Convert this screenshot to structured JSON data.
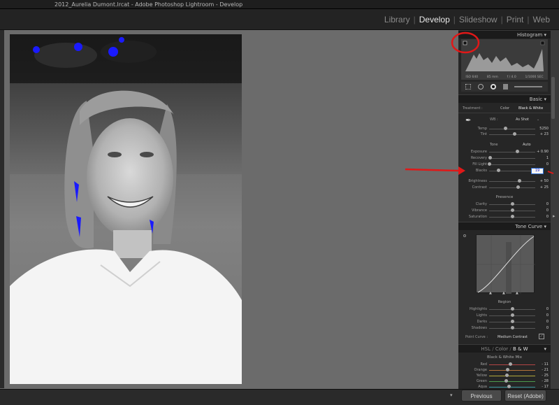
{
  "window": {
    "title": "2012_Aurelia Dumont.lrcat - Adobe Photoshop Lightroom - Develop"
  },
  "modules": [
    {
      "label": "Library",
      "active": false
    },
    {
      "label": "Develop",
      "active": true
    },
    {
      "label": "Slideshow",
      "active": false
    },
    {
      "label": "Print",
      "active": false
    },
    {
      "label": "Web",
      "active": false
    }
  ],
  "histogram": {
    "title": "Histogram",
    "info": {
      "iso": "ISO 640",
      "focal": "85 mm",
      "aperture": "f / 4.0",
      "shutter": "1/1000 SEC"
    }
  },
  "basic": {
    "title": "Basic",
    "treatment_label": "Treatment :",
    "treatment_color": "Color",
    "treatment_bw": "Black & White",
    "wb_label": "WB :",
    "wb_value": "As Shot",
    "temp": {
      "label": "Temp",
      "value": "5250",
      "position": 0.35
    },
    "tint": {
      "label": "Tint",
      "value": "+ 23",
      "position": 0.55
    },
    "tone_label": "Tone",
    "auto_label": "Auto",
    "exposure": {
      "label": "Exposure",
      "value": "+ 0.90",
      "position": 0.6
    },
    "recovery": {
      "label": "Recovery",
      "value": "1",
      "position": 0.02
    },
    "fill_light": {
      "label": "Fill Light",
      "value": "0",
      "position": 0.0
    },
    "blacks": {
      "label": "Blacks",
      "value": "19",
      "position": 0.19
    },
    "brightness": {
      "label": "Brightness",
      "value": "+ 50",
      "position": 0.65
    },
    "contrast": {
      "label": "Contrast",
      "value": "+ 25",
      "position": 0.62
    },
    "presence_label": "Presence",
    "clarity": {
      "label": "Clarity",
      "value": "0",
      "position": 0.5
    },
    "vibrance": {
      "label": "Vibrance",
      "value": "0",
      "position": 0.5
    },
    "saturation": {
      "label": "Saturation",
      "value": "0",
      "position": 0.5
    }
  },
  "tone_curve": {
    "title": "Tone Curve",
    "region_label": "Region",
    "highlights": {
      "label": "Highlights",
      "value": "0",
      "position": 0.5
    },
    "lights": {
      "label": "Lights",
      "value": "0",
      "position": 0.5
    },
    "darks": {
      "label": "Darks",
      "value": "0",
      "position": 0.5
    },
    "shadows": {
      "label": "Shadows",
      "value": "0",
      "position": 0.5
    },
    "point_curve_label": "Point Curve :",
    "point_curve_value": "Medium Contrast"
  },
  "hsl": {
    "title_hsl": "HSL",
    "title_color": "Color",
    "title_bw": "B & W",
    "mix_label": "Black & White Mix",
    "red": {
      "label": "Red",
      "value": "- 11",
      "position": 0.45
    },
    "orange": {
      "label": "Orange",
      "value": "- 21",
      "position": 0.4
    },
    "yellow": {
      "label": "Yellow",
      "value": "- 25",
      "position": 0.38
    },
    "green": {
      "label": "Green",
      "value": "- 28",
      "position": 0.36
    },
    "aqua": {
      "label": "Aqua",
      "value": "- 17",
      "position": 0.42
    }
  },
  "footer": {
    "previous_label": "Previous",
    "reset_label": "Reset (Adobe)"
  },
  "colors": {
    "annotation_red": "#e01818",
    "clipping_blue": "#1a1aff",
    "active_text": "#e8e8e8"
  }
}
